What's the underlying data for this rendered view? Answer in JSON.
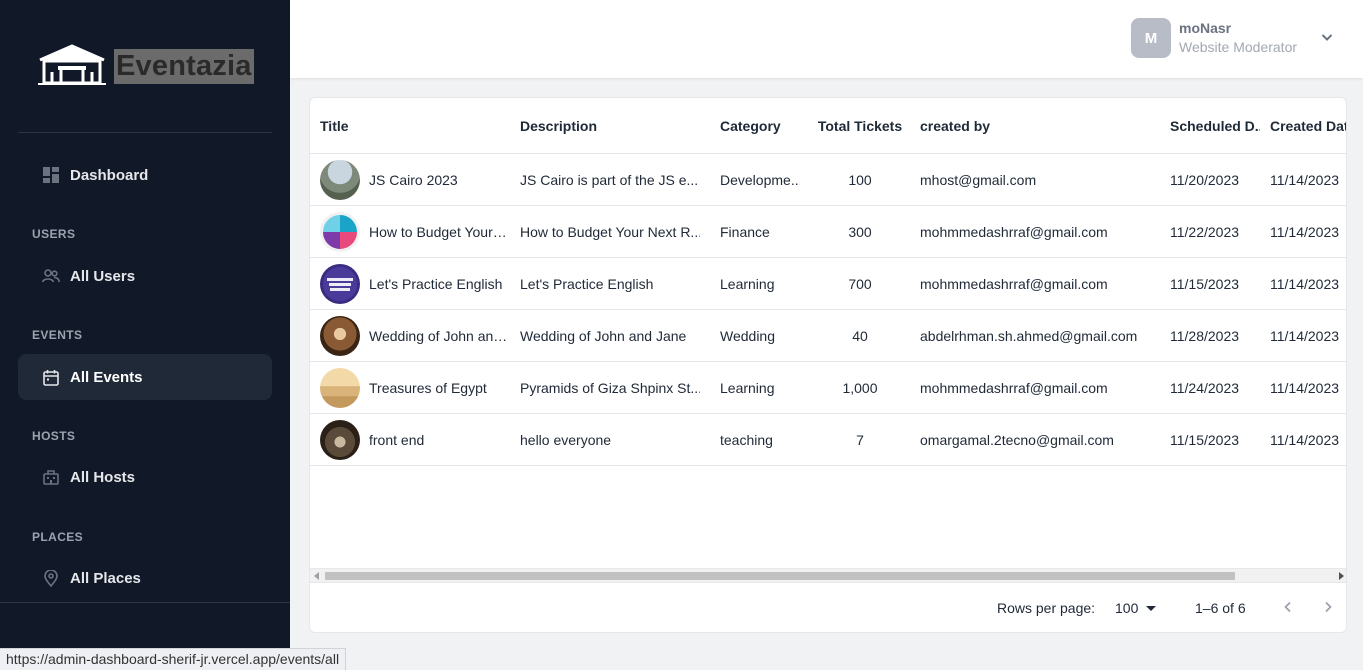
{
  "app": {
    "name": "Eventazia"
  },
  "sidebar": {
    "dashboard": "Dashboard",
    "sections": {
      "users": "USERS",
      "events": "EVENTS",
      "hosts": "HOSTS",
      "places": "PLACES"
    },
    "items": {
      "all_users": "All Users",
      "all_events": "All Events",
      "all_hosts": "All Hosts",
      "all_places": "All Places"
    },
    "active": "All Events"
  },
  "header": {
    "avatar_initial": "M",
    "user_name": "moNasr",
    "user_role": "Website Moderator"
  },
  "table": {
    "columns": {
      "title": "Title",
      "description": "Description",
      "category": "Category",
      "total_tickets": "Total Tickets",
      "created_by": "created by",
      "scheduled": "Scheduled D...",
      "created": "Created Date"
    },
    "rows": [
      {
        "title": "JS Cairo 2023",
        "description": "JS Cairo is part of the JS e...",
        "category": "Developme...",
        "tickets": "100",
        "creator": "mhost@gmail.com",
        "scheduled": "11/20/2023",
        "created": "11/14/2023"
      },
      {
        "title": "How to Budget Your Ne",
        "description": "How to Budget Your Next R...",
        "category": "Finance",
        "tickets": "300",
        "creator": "mohmmedashrraf@gmail.com",
        "scheduled": "11/22/2023",
        "created": "11/14/2023"
      },
      {
        "title": "Let's Practice English",
        "description": "Let's Practice English",
        "category": "Learning",
        "tickets": "700",
        "creator": "mohmmedashrraf@gmail.com",
        "scheduled": "11/15/2023",
        "created": "11/14/2023"
      },
      {
        "title": "Wedding of John and J",
        "description": "Wedding of John and Jane",
        "category": "Wedding",
        "tickets": "40",
        "creator": "abdelrhman.sh.ahmed@gmail.com",
        "scheduled": "11/28/2023",
        "created": "11/14/2023"
      },
      {
        "title": "Treasures of Egypt",
        "description": "Pyramids of Giza Shpinx St...",
        "category": "Learning",
        "tickets": "1,000",
        "creator": "mohmmedashrraf@gmail.com",
        "scheduled": "11/24/2023",
        "created": "11/14/2023"
      },
      {
        "title": "front end",
        "description": "hello everyone",
        "category": "teaching",
        "tickets": "7",
        "creator": "omargamal.2tecno@gmail.com",
        "scheduled": "11/15/2023",
        "created": "11/14/2023"
      }
    ]
  },
  "pagination": {
    "rows_per_page_label": "Rows per page:",
    "rows_per_page": "100",
    "range": "1–6 of 6"
  },
  "status_url": "https://admin-dashboard-sherif-jr.vercel.app/events/all",
  "icons": {
    "logo": "tent-icon",
    "dashboard": "dashboard-grid-icon",
    "users": "users-icon",
    "events": "calendar-icon",
    "hosts": "building-icon",
    "places": "map-pin-icon",
    "user_menu": "chevron-down-icon",
    "prev": "chevron-left-icon",
    "next": "chevron-right-icon"
  }
}
